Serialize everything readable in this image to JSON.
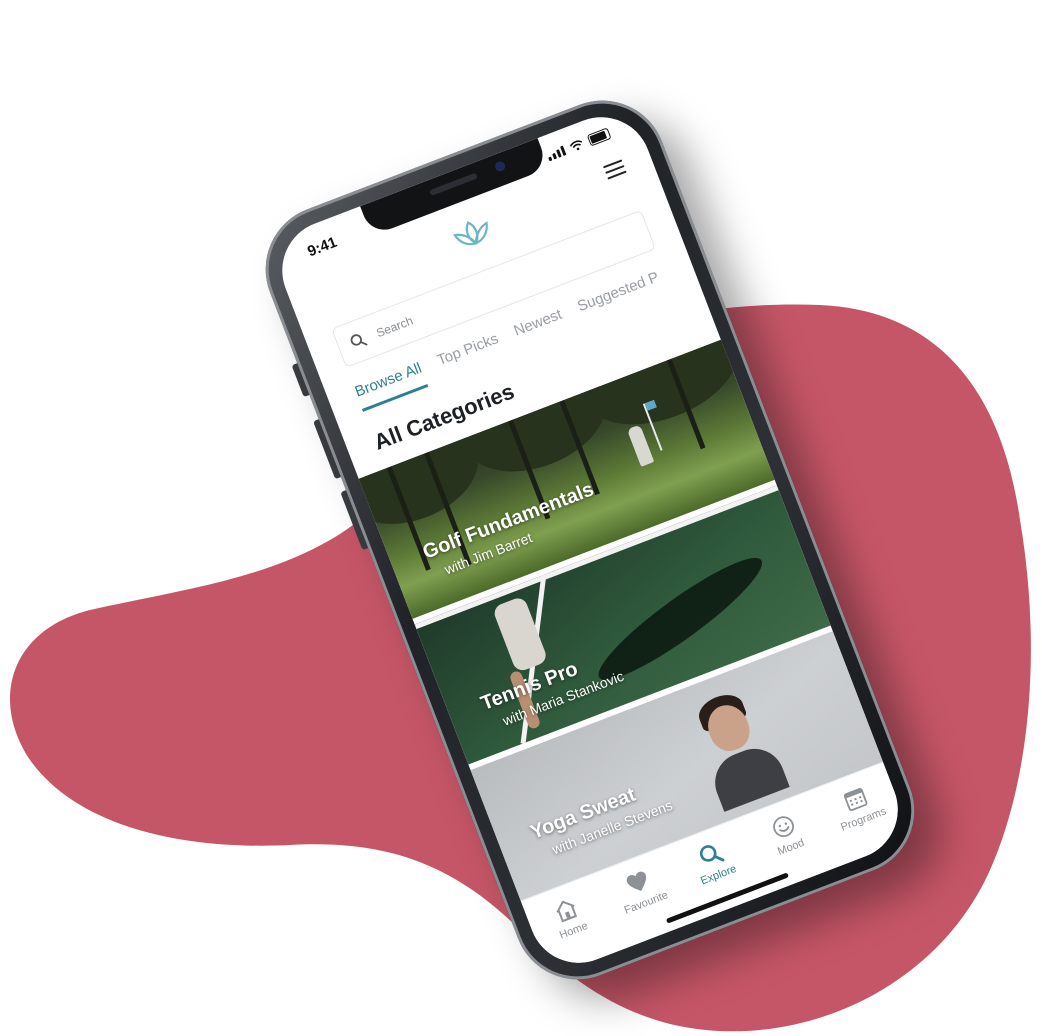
{
  "colors": {
    "blob": "#c55667",
    "accent": "#2f7f92",
    "inactive": "#9a9ea3"
  },
  "status_bar": {
    "time": "9:41"
  },
  "header": {
    "logo_icon": "lotus-icon",
    "menu_icon": "hamburger-menu-icon"
  },
  "search": {
    "placeholder": "Search"
  },
  "tabs": [
    {
      "label": "Browse All",
      "active": true
    },
    {
      "label": "Top Picks",
      "active": false
    },
    {
      "label": "Newest",
      "active": false
    },
    {
      "label": "Suggested P",
      "active": false
    }
  ],
  "section_title": "All Categories",
  "cards": [
    {
      "title": "Golf Fundamentals",
      "subtitle": "with Jim Barret"
    },
    {
      "title": "Tennis Pro",
      "subtitle": "with Maria Stankovic"
    },
    {
      "title": "Yoga Sweat",
      "subtitle": "with Janelle Stevens"
    }
  ],
  "nav": [
    {
      "label": "Home",
      "icon": "home-icon",
      "active": false
    },
    {
      "label": "Favourite",
      "icon": "heart-icon",
      "active": false
    },
    {
      "label": "Explore",
      "icon": "search-icon",
      "active": true
    },
    {
      "label": "Mood",
      "icon": "smiley-icon",
      "active": false
    },
    {
      "label": "Programs",
      "icon": "calendar-icon",
      "active": false
    }
  ]
}
